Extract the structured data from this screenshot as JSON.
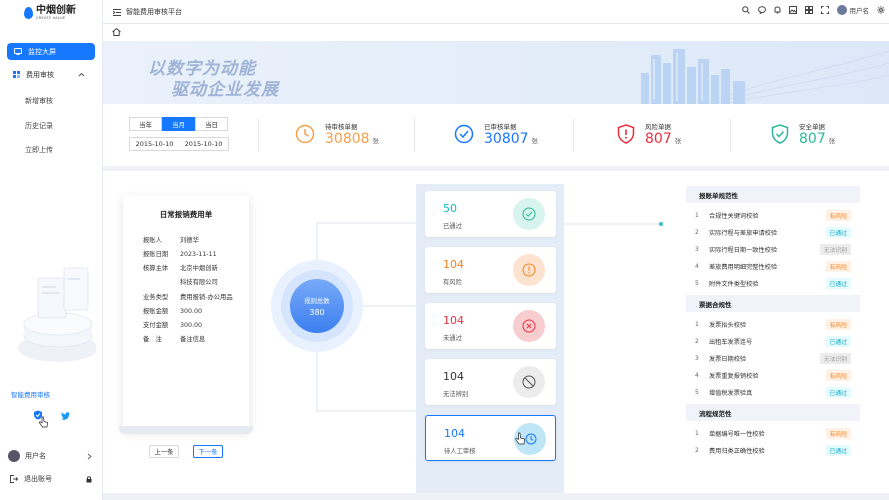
{
  "app": {
    "logo_cn": "中烟创新",
    "logo_en": "CREATE VALUE",
    "title": "智能费用审核平台"
  },
  "sidebar": {
    "items": [
      {
        "label": "监控大屏",
        "active": true
      },
      {
        "label": "费用审核",
        "expanded": true
      }
    ],
    "sub_items": [
      "新增审核",
      "历史记录",
      "立即上传"
    ],
    "assistant_label": "智能费用审核",
    "user_name": "用户名",
    "logout_label": "退出账号"
  },
  "header": {
    "user_name": "用户名",
    "icons": [
      "search-icon",
      "message-icon",
      "bell-icon",
      "image-icon",
      "grid-icon",
      "fullscreen-icon",
      "avatar",
      "settings-icon"
    ]
  },
  "banner": {
    "line1": "以数字为动能",
    "line2": "驱动企业发展"
  },
  "filters": {
    "tabs": [
      "当年",
      "当月",
      "当日"
    ],
    "active_tab": "当月",
    "date_start": "2015-10-10",
    "date_end": "2015-10-10"
  },
  "stats": [
    {
      "label": "待审核单据",
      "value": "30808",
      "unit": "张",
      "color": "#f5a04a",
      "icon": "clock-icon"
    },
    {
      "label": "已审核单据",
      "value": "30807",
      "unit": "张",
      "color": "#1677ff",
      "icon": "check-circle-icon"
    },
    {
      "label": "风险单据",
      "value": "807",
      "unit": "张",
      "color": "#e8303e",
      "icon": "shield-alert-icon"
    },
    {
      "label": "安全单据",
      "value": "807",
      "unit": "张",
      "color": "#2bb89a",
      "icon": "shield-check-icon"
    }
  ],
  "receipt": {
    "title": "日常报销费用单",
    "fields": [
      {
        "k": "报账人",
        "v": "刘德华"
      },
      {
        "k": "报账日期",
        "v": "2023-11-11"
      },
      {
        "k": "核算主体",
        "v": "北京中烟创新"
      },
      {
        "k": "",
        "v": "科技有限公司"
      },
      {
        "k": "业务类型",
        "v": "费用报销-办公用品"
      },
      {
        "k": "报账金额",
        "v": "300.00"
      },
      {
        "k": "支付金额",
        "v": "300.00"
      },
      {
        "k": "备　注",
        "v": "备注信息"
      }
    ],
    "prev_label": "上一条",
    "next_label": "下一条"
  },
  "total": {
    "label": "规则总数",
    "value": "380"
  },
  "results": [
    {
      "value": "50",
      "label": "已通过",
      "color": "#13b5c8",
      "icon": "pass-icon"
    },
    {
      "value": "104",
      "label": "有风险",
      "color": "#f5821f",
      "icon": "warning-icon"
    },
    {
      "value": "104",
      "label": "未通过",
      "color": "#e8303e",
      "icon": "fail-icon"
    },
    {
      "value": "104",
      "label": "无法辨别",
      "color": "#333333",
      "icon": "ban-icon"
    },
    {
      "value": "104",
      "label": "待人工审核",
      "color": "#1677ff",
      "icon": "manual-review-icon"
    }
  ],
  "checks": [
    {
      "section": "报账单规范性",
      "items": [
        {
          "no": "1",
          "text": "合规性关键词校验",
          "status": "有风险"
        },
        {
          "no": "2",
          "text": "实际行程与差旅申请校验",
          "status": "已通过"
        },
        {
          "no": "3",
          "text": "实际行程日期一致性校验",
          "status": "无法识别"
        },
        {
          "no": "4",
          "text": "差旅费用明细完整性校验",
          "status": "有风险"
        },
        {
          "no": "5",
          "text": "附件文件类型校验",
          "status": "已通过"
        }
      ]
    },
    {
      "section": "票据合规性",
      "items": [
        {
          "no": "1",
          "text": "发票抬头校验",
          "status": "有风险"
        },
        {
          "no": "2",
          "text": "出租车发票连号",
          "status": "已通过"
        },
        {
          "no": "3",
          "text": "发票日期校验",
          "status": "无法识别"
        },
        {
          "no": "4",
          "text": "发票重复报销校验",
          "status": "有风险"
        },
        {
          "no": "5",
          "text": "增值税发票验真",
          "status": "已通过"
        }
      ]
    },
    {
      "section": "流程规范性",
      "items": [
        {
          "no": "1",
          "text": "单据编号唯一性校验",
          "status": "有风险"
        },
        {
          "no": "2",
          "text": "费用归类正确性校验",
          "status": "已通过"
        }
      ]
    }
  ]
}
